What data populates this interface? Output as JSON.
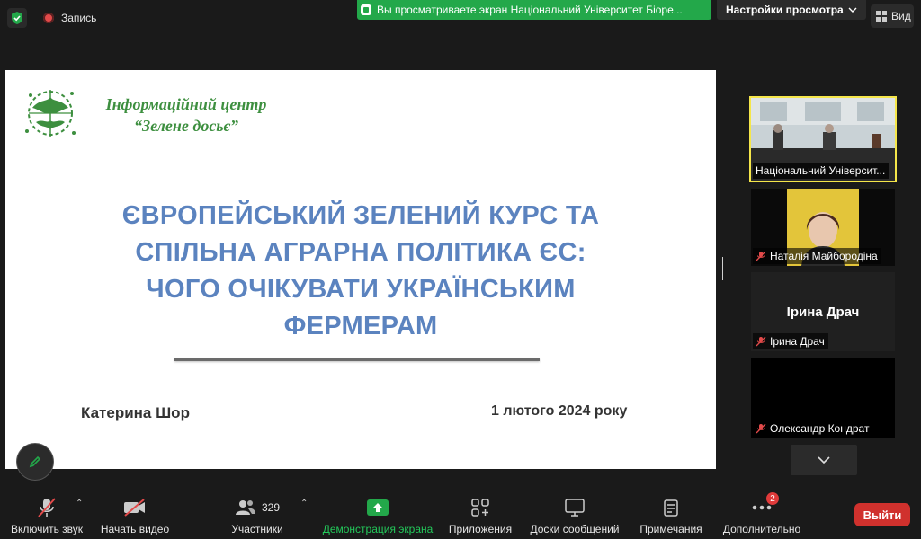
{
  "top_bar": {
    "recording_label": "Запись",
    "share_banner_text": "Вы просматриваете экран Національний Університет Біоре...",
    "view_settings_label": "Настройки просмотра",
    "view_label": "Вид"
  },
  "slide": {
    "org_name_line1": "Інформаційний центр",
    "org_name_line2": "“Зелене досьє”",
    "title_lines": [
      "ЄВРОПЕЙСЬКИЙ ЗЕЛЕНИЙ КУРС ТА",
      "СПІЛЬНА АГРАРНА ПОЛІТИКА ЄС:",
      "ЧОГО ОЧІКУВАТИ УКРАЇНСЬКИМ",
      "ФЕРМЕРАМ"
    ],
    "author": "Катерина Шор",
    "date": "1 лютого 2024 року"
  },
  "participants": [
    {
      "name": "Національний Університ...",
      "muted": false,
      "video": true
    },
    {
      "name": "Наталія Майбородіна",
      "muted": true,
      "video": true
    },
    {
      "name": "Ірина Драч",
      "muted": true,
      "video": false,
      "display_name": "Ірина Драч"
    },
    {
      "name": "Олександр Кондрат",
      "muted": true,
      "video": true
    }
  ],
  "toolbar": {
    "unmute_label": "Включить звук",
    "start_video_label": "Начать видео",
    "participants_label": "Участники",
    "participants_count": "329",
    "share_screen_label": "Демонстрация экрана",
    "apps_label": "Приложения",
    "whiteboards_label": "Доски сообщений",
    "notes_label": "Примечания",
    "more_label": "Дополнительно",
    "more_badge": "2",
    "leave_label": "Выйти"
  },
  "colors": {
    "share_green": "#23a84a",
    "title_blue": "#5b83bf",
    "org_green": "#3d8f3f",
    "leave_red": "#d0312d",
    "active_speaker": "#f5e64a"
  }
}
